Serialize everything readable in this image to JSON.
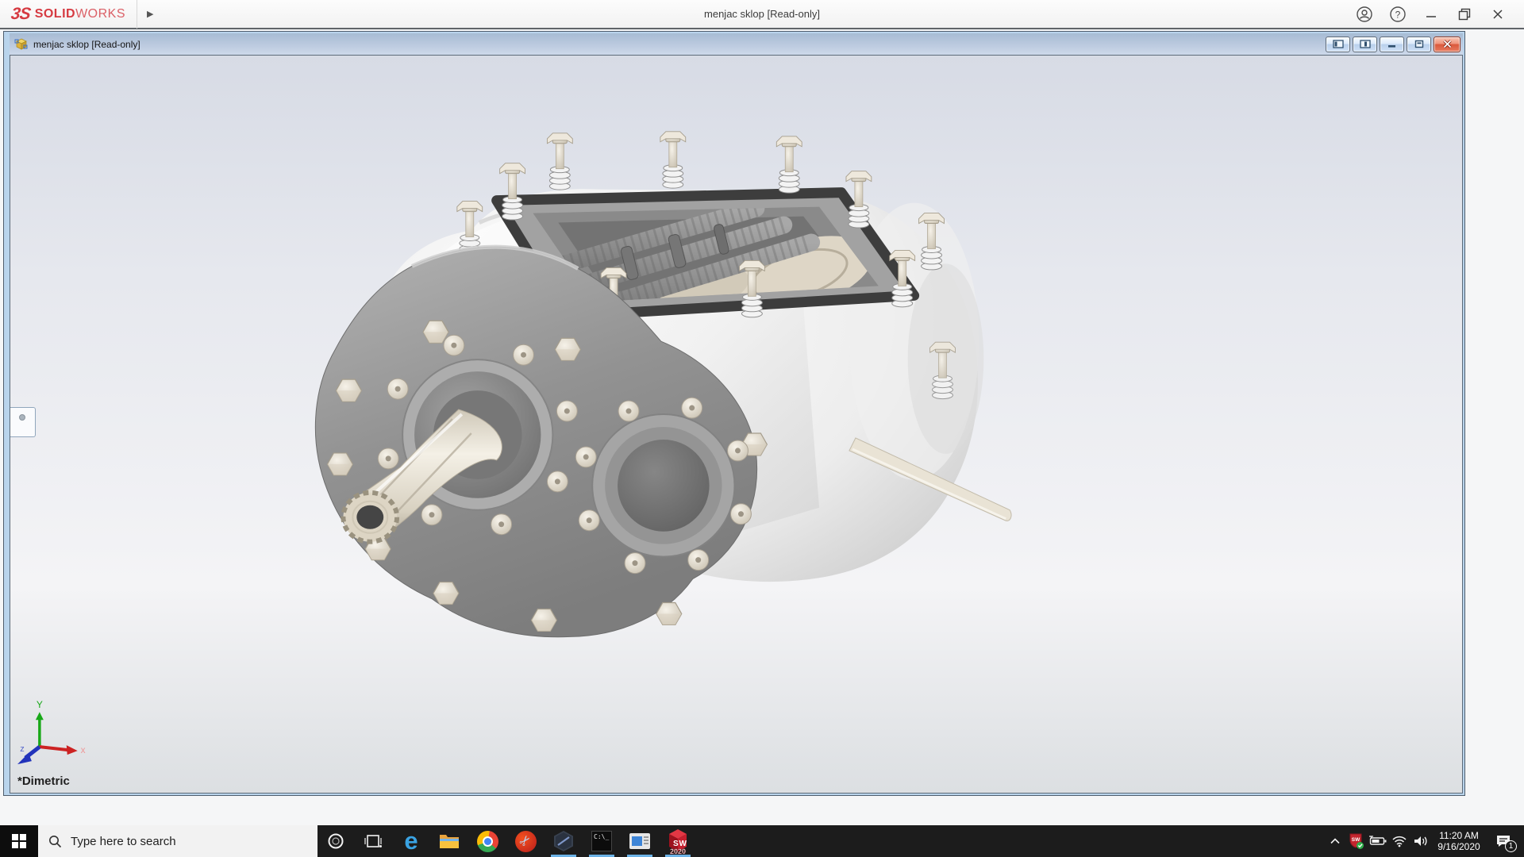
{
  "app_bar": {
    "brand_mark": "3S",
    "brand_solid": "SOLID",
    "brand_works": "WORKS",
    "title": "menjac sklop [Read-only]"
  },
  "doc_window": {
    "title": "menjac sklop [Read-only]",
    "view_orientation": "*Dimetric",
    "triad": {
      "x": "x",
      "y": "Y",
      "z": "z"
    }
  },
  "taskbar": {
    "search_placeholder": "Type here to search",
    "clock_time": "11:20 AM",
    "clock_date": "9/16/2020",
    "notification_count": "1"
  },
  "icons": {
    "edge_glyph": "e",
    "scissors_glyph": "✂",
    "help_glyph": "?",
    "cmd_text": "C:\\_",
    "sw_letter_s": "S",
    "sw_letter_w": "W",
    "sw_year": "2020"
  },
  "colors": {
    "solidworks_red": "#d63a41",
    "doc_titlebar_top": "#a7bcd4",
    "close_button_red": "#d9593c",
    "running_indicator": "#6cb2e6",
    "viewport_gradient_top": "#d7dbe5",
    "viewport_gradient_bottom": "#dcdfe2"
  }
}
